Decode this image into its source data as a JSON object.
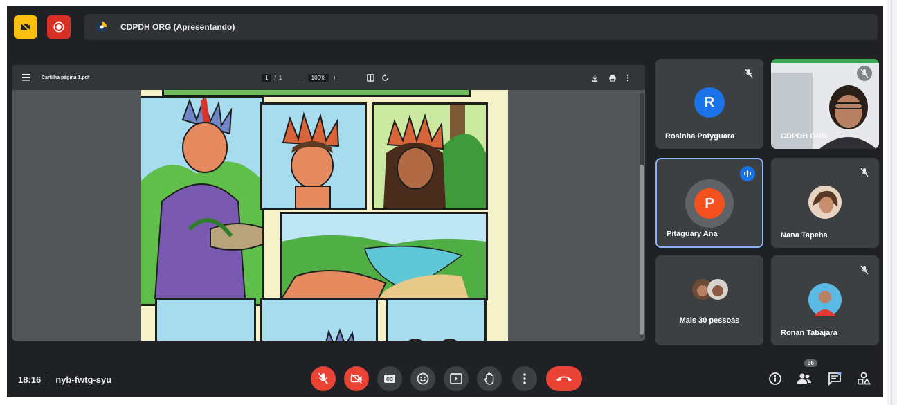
{
  "meeting": {
    "presenter_title": "CDPDH ORG (Apresentando)",
    "time": "18:16",
    "code": "nyb-fwtg-syu"
  },
  "pdf": {
    "file_name": "Cartilha página 1.pdf",
    "page_current": "1",
    "page_total": "1",
    "zoom": "100%"
  },
  "participants": [
    {
      "name": "Rosinha Potyguara",
      "initial": "R",
      "avatar_color": "#1a73e8",
      "muted": true
    },
    {
      "name": "CDPDH ORG",
      "muted": true,
      "video": true
    },
    {
      "name": "Pitaguary Ana",
      "initial": "P",
      "avatar_color": "#f4511e",
      "speaking": true
    },
    {
      "name": "Nana Tapeba",
      "muted": true
    },
    {
      "name": "Mais 30 pessoas"
    },
    {
      "name": "Ronan Tabajara",
      "muted": true
    }
  ],
  "people_count": "36",
  "icons": {
    "top": [
      "camera-off-icon",
      "record-icon",
      "presenting-logo-icon"
    ],
    "controls": [
      "mic-off-icon",
      "camera-off-icon",
      "captions-icon",
      "emoji-icon",
      "present-icon",
      "raise-hand-icon",
      "more-options-icon",
      "hang-up-icon"
    ],
    "right": [
      "info-icon",
      "people-icon",
      "chat-icon",
      "activities-icon"
    ]
  },
  "colors": {
    "background": "#202124",
    "tile": "#3c4043",
    "accent_red": "#ea4335",
    "accent_blue": "#8ab4f8",
    "cam_yellow": "#f9c00f"
  }
}
